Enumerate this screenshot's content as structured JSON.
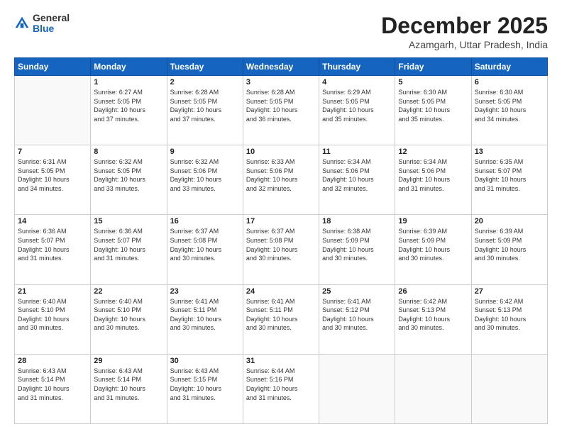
{
  "logo": {
    "general": "General",
    "blue": "Blue"
  },
  "header": {
    "month": "December 2025",
    "location": "Azamgarh, Uttar Pradesh, India"
  },
  "weekdays": [
    "Sunday",
    "Monday",
    "Tuesday",
    "Wednesday",
    "Thursday",
    "Friday",
    "Saturday"
  ],
  "weeks": [
    [
      {
        "day": "",
        "info": ""
      },
      {
        "day": "1",
        "info": "Sunrise: 6:27 AM\nSunset: 5:05 PM\nDaylight: 10 hours\nand 37 minutes."
      },
      {
        "day": "2",
        "info": "Sunrise: 6:28 AM\nSunset: 5:05 PM\nDaylight: 10 hours\nand 37 minutes."
      },
      {
        "day": "3",
        "info": "Sunrise: 6:28 AM\nSunset: 5:05 PM\nDaylight: 10 hours\nand 36 minutes."
      },
      {
        "day": "4",
        "info": "Sunrise: 6:29 AM\nSunset: 5:05 PM\nDaylight: 10 hours\nand 35 minutes."
      },
      {
        "day": "5",
        "info": "Sunrise: 6:30 AM\nSunset: 5:05 PM\nDaylight: 10 hours\nand 35 minutes."
      },
      {
        "day": "6",
        "info": "Sunrise: 6:30 AM\nSunset: 5:05 PM\nDaylight: 10 hours\nand 34 minutes."
      }
    ],
    [
      {
        "day": "7",
        "info": "Sunrise: 6:31 AM\nSunset: 5:05 PM\nDaylight: 10 hours\nand 34 minutes."
      },
      {
        "day": "8",
        "info": "Sunrise: 6:32 AM\nSunset: 5:05 PM\nDaylight: 10 hours\nand 33 minutes."
      },
      {
        "day": "9",
        "info": "Sunrise: 6:32 AM\nSunset: 5:06 PM\nDaylight: 10 hours\nand 33 minutes."
      },
      {
        "day": "10",
        "info": "Sunrise: 6:33 AM\nSunset: 5:06 PM\nDaylight: 10 hours\nand 32 minutes."
      },
      {
        "day": "11",
        "info": "Sunrise: 6:34 AM\nSunset: 5:06 PM\nDaylight: 10 hours\nand 32 minutes."
      },
      {
        "day": "12",
        "info": "Sunrise: 6:34 AM\nSunset: 5:06 PM\nDaylight: 10 hours\nand 31 minutes."
      },
      {
        "day": "13",
        "info": "Sunrise: 6:35 AM\nSunset: 5:07 PM\nDaylight: 10 hours\nand 31 minutes."
      }
    ],
    [
      {
        "day": "14",
        "info": "Sunrise: 6:36 AM\nSunset: 5:07 PM\nDaylight: 10 hours\nand 31 minutes."
      },
      {
        "day": "15",
        "info": "Sunrise: 6:36 AM\nSunset: 5:07 PM\nDaylight: 10 hours\nand 31 minutes."
      },
      {
        "day": "16",
        "info": "Sunrise: 6:37 AM\nSunset: 5:08 PM\nDaylight: 10 hours\nand 30 minutes."
      },
      {
        "day": "17",
        "info": "Sunrise: 6:37 AM\nSunset: 5:08 PM\nDaylight: 10 hours\nand 30 minutes."
      },
      {
        "day": "18",
        "info": "Sunrise: 6:38 AM\nSunset: 5:09 PM\nDaylight: 10 hours\nand 30 minutes."
      },
      {
        "day": "19",
        "info": "Sunrise: 6:39 AM\nSunset: 5:09 PM\nDaylight: 10 hours\nand 30 minutes."
      },
      {
        "day": "20",
        "info": "Sunrise: 6:39 AM\nSunset: 5:09 PM\nDaylight: 10 hours\nand 30 minutes."
      }
    ],
    [
      {
        "day": "21",
        "info": "Sunrise: 6:40 AM\nSunset: 5:10 PM\nDaylight: 10 hours\nand 30 minutes."
      },
      {
        "day": "22",
        "info": "Sunrise: 6:40 AM\nSunset: 5:10 PM\nDaylight: 10 hours\nand 30 minutes."
      },
      {
        "day": "23",
        "info": "Sunrise: 6:41 AM\nSunset: 5:11 PM\nDaylight: 10 hours\nand 30 minutes."
      },
      {
        "day": "24",
        "info": "Sunrise: 6:41 AM\nSunset: 5:11 PM\nDaylight: 10 hours\nand 30 minutes."
      },
      {
        "day": "25",
        "info": "Sunrise: 6:41 AM\nSunset: 5:12 PM\nDaylight: 10 hours\nand 30 minutes."
      },
      {
        "day": "26",
        "info": "Sunrise: 6:42 AM\nSunset: 5:13 PM\nDaylight: 10 hours\nand 30 minutes."
      },
      {
        "day": "27",
        "info": "Sunrise: 6:42 AM\nSunset: 5:13 PM\nDaylight: 10 hours\nand 30 minutes."
      }
    ],
    [
      {
        "day": "28",
        "info": "Sunrise: 6:43 AM\nSunset: 5:14 PM\nDaylight: 10 hours\nand 31 minutes."
      },
      {
        "day": "29",
        "info": "Sunrise: 6:43 AM\nSunset: 5:14 PM\nDaylight: 10 hours\nand 31 minutes."
      },
      {
        "day": "30",
        "info": "Sunrise: 6:43 AM\nSunset: 5:15 PM\nDaylight: 10 hours\nand 31 minutes."
      },
      {
        "day": "31",
        "info": "Sunrise: 6:44 AM\nSunset: 5:16 PM\nDaylight: 10 hours\nand 31 minutes."
      },
      {
        "day": "",
        "info": ""
      },
      {
        "day": "",
        "info": ""
      },
      {
        "day": "",
        "info": ""
      }
    ]
  ]
}
